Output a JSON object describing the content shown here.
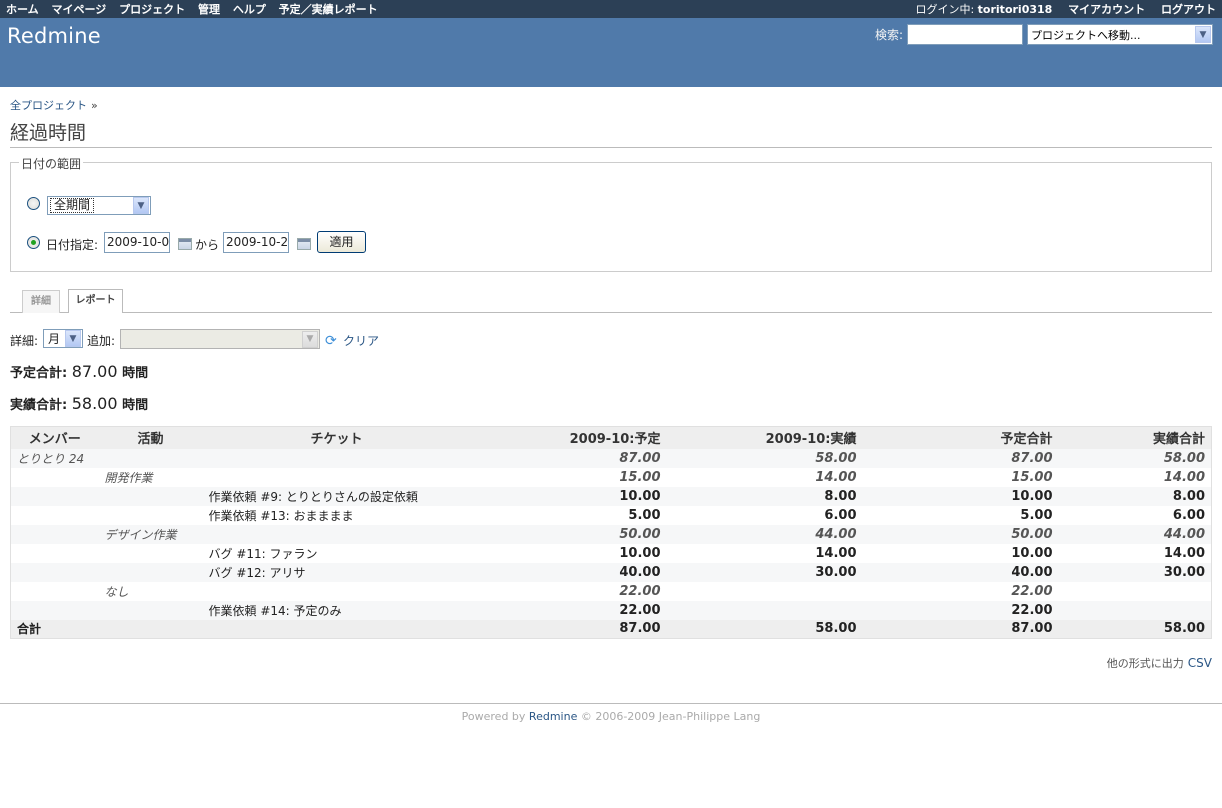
{
  "top_menu": {
    "items": [
      "ホーム",
      "マイページ",
      "プロジェクト",
      "管理",
      "ヘルプ",
      "予定／実績レポート"
    ],
    "login_label": "ログイン中:",
    "login_user": "toritori0318",
    "my_account": "マイアカウント",
    "logout": "ログアウト"
  },
  "header": {
    "app_title": "Redmine",
    "search_label": "検索:",
    "search_value": "",
    "jump_to_project": "プロジェクトへ移動..."
  },
  "breadcrumb": {
    "root": "全プロジェクト",
    "sep": "»"
  },
  "page_title": "経過時間",
  "date_range": {
    "legend": "日付の範囲",
    "period_option": "全期間",
    "date_label": "日付指定:",
    "from": "2009-10-0",
    "between": "から",
    "to": "2009-10-2",
    "apply": "適用"
  },
  "tabs": [
    "詳細",
    "レポート"
  ],
  "criteria": {
    "detail_label": "詳細:",
    "detail_value": "月",
    "add_label": "追加:",
    "add_value": "",
    "clear": "クリア"
  },
  "totals": {
    "planned_label": "予定合計:",
    "planned_value": "87.00",
    "actual_label": "実績合計:",
    "actual_value": "58.00",
    "unit": "時間"
  },
  "table": {
    "headers": [
      "メンバー",
      "活動",
      "チケット",
      "2009-10:予定",
      "2009-10:実績",
      "予定合計",
      "実績合計"
    ],
    "rows": [
      {
        "member": "とりとり 24",
        "activity": "",
        "ticket": "",
        "v": [
          "87.00",
          "58.00",
          "87.00",
          "58.00"
        ],
        "style": "odd italic"
      },
      {
        "member": "",
        "activity": "開発作業",
        "ticket": "",
        "v": [
          "15.00",
          "14.00",
          "15.00",
          "14.00"
        ],
        "style": "even italic"
      },
      {
        "member": "",
        "activity": "",
        "ticket": "作業依頼 #9: とりとりさんの設定依頼",
        "v": [
          "10.00",
          "8.00",
          "10.00",
          "8.00"
        ],
        "style": "odd"
      },
      {
        "member": "",
        "activity": "",
        "ticket": "作業依頼 #13: おまままま",
        "v": [
          "5.00",
          "6.00",
          "5.00",
          "6.00"
        ],
        "style": "even"
      },
      {
        "member": "",
        "activity": "デザイン作業",
        "ticket": "",
        "v": [
          "50.00",
          "44.00",
          "50.00",
          "44.00"
        ],
        "style": "odd italic"
      },
      {
        "member": "",
        "activity": "",
        "ticket": "バグ #11: ファラン",
        "v": [
          "10.00",
          "14.00",
          "10.00",
          "14.00"
        ],
        "style": "even"
      },
      {
        "member": "",
        "activity": "",
        "ticket": "バグ #12: アリサ",
        "v": [
          "40.00",
          "30.00",
          "40.00",
          "30.00"
        ],
        "style": "odd"
      },
      {
        "member": "",
        "activity": "なし",
        "ticket": "",
        "v": [
          "22.00",
          "",
          "22.00",
          ""
        ],
        "style": "even italic"
      },
      {
        "member": "",
        "activity": "",
        "ticket": "作業依頼 #14: 予定のみ",
        "v": [
          "22.00",
          "",
          "22.00",
          ""
        ],
        "style": "odd"
      }
    ],
    "total_row": {
      "label": "合計",
      "v": [
        "87.00",
        "58.00",
        "87.00",
        "58.00"
      ]
    }
  },
  "other_formats": {
    "label": "他の形式に出力",
    "csv": "CSV"
  },
  "footer": {
    "powered_by": "Powered by",
    "link": "Redmine",
    "copyright": "© 2006-2009 Jean-Philippe Lang"
  }
}
